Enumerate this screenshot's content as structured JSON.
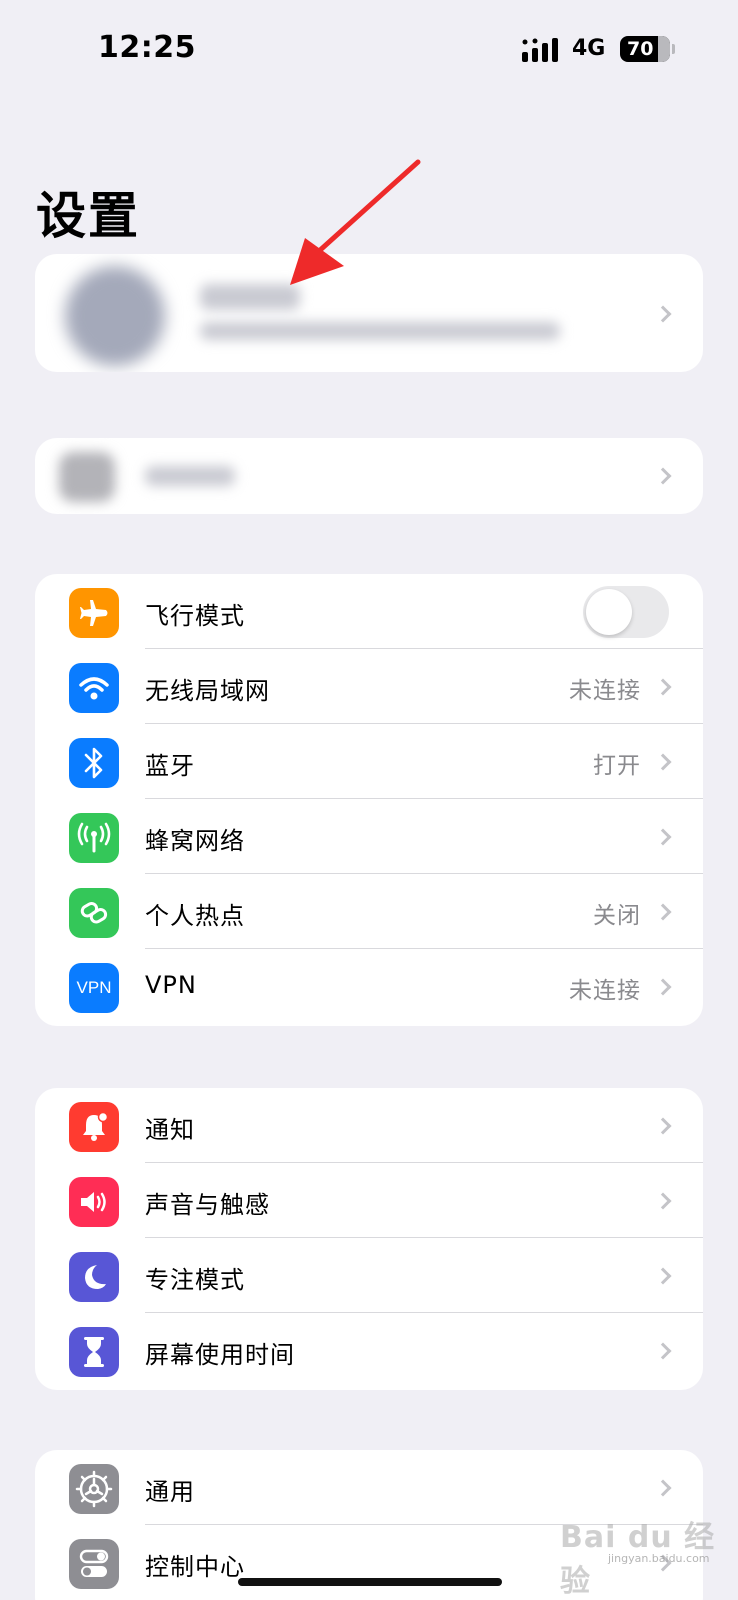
{
  "status_bar": {
    "time": "12:25",
    "network": "4G",
    "battery": "70",
    "signal_icon": "signal-bars-icon"
  },
  "page": {
    "title": "设置"
  },
  "network_group": [
    {
      "label": "飞行模式",
      "icon": "airplane-icon",
      "icon_color": "#ff9500",
      "value": "",
      "toggle": true,
      "toggle_on": false
    },
    {
      "label": "无线局域网",
      "icon": "wifi-icon",
      "icon_color": "#0a7cff",
      "value": "未连接"
    },
    {
      "label": "蓝牙",
      "icon": "bluetooth-icon",
      "icon_color": "#0a7cff",
      "value": "打开"
    },
    {
      "label": "蜂窝网络",
      "icon": "cellular-icon",
      "icon_color": "#34c759",
      "value": ""
    },
    {
      "label": "个人热点",
      "icon": "hotspot-icon",
      "icon_color": "#34c759",
      "value": "关闭"
    },
    {
      "label": "VPN",
      "icon": "vpn-icon",
      "icon_color": "#0a7cff",
      "value": "未连接",
      "icon_text": "VPN"
    }
  ],
  "notify_group": [
    {
      "label": "通知",
      "icon": "bell-icon",
      "icon_color": "#ff3b30"
    },
    {
      "label": "声音与触感",
      "icon": "speaker-icon",
      "icon_color": "#ff2d55"
    },
    {
      "label": "专注模式",
      "icon": "moon-icon",
      "icon_color": "#5856d6"
    },
    {
      "label": "屏幕使用时间",
      "icon": "hourglass-icon",
      "icon_color": "#5856d6"
    }
  ],
  "general_group": [
    {
      "label": "通用",
      "icon": "gear-icon",
      "icon_color": "#8e8e93"
    },
    {
      "label": "控制中心",
      "icon": "toggles-icon",
      "icon_color": "#8e8e93"
    }
  ],
  "watermark": {
    "brand": "Bai du 经验",
    "url": "jingyan.baidu.com"
  }
}
